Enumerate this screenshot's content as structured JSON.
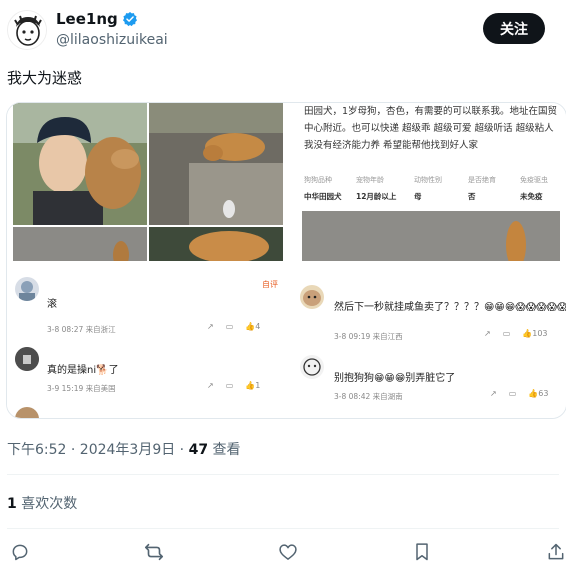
{
  "author": {
    "display_name": "Lee1ng",
    "handle": "@lilaoshizuikeai",
    "follow_label": "关注",
    "verified_color": "#1d9bf0"
  },
  "tweet": {
    "text": "我大为迷惑"
  },
  "media": {
    "post_excerpt": "田园犬，1岁母狗，杏色，有需要的可以联系我。地址在国贸中心附近。也可以快递 超级乖 超级可爱 超级听话 超级粘人 我没有经济能力养 希望能帮他找到好人家",
    "info": [
      {
        "head": "狗狗品种",
        "value": "中华田园犬"
      },
      {
        "head": "宠物年龄",
        "value": "12月龄以上"
      },
      {
        "head": "动物性别",
        "value": "母"
      },
      {
        "head": "是否绝育",
        "value": "否"
      },
      {
        "head": "免疫驱虫",
        "value": "未免疫"
      }
    ],
    "left_comments": [
      {
        "text": "滚",
        "meta": "3-8 08:27 来自浙江",
        "likes": "4"
      },
      {
        "text": "真的是操ni🐕了",
        "meta": "3-9 15:19 来自美国",
        "likes": "1"
      }
    ],
    "right_comments": [
      {
        "text": "然后下一秒就挂咸鱼卖了？？？？😁😁😁😱😱😱😱😱",
        "meta": "3-8 09:19 来自江西",
        "likes": "103"
      },
      {
        "text": "别抱狗狗😁😁😁别弄脏它了",
        "meta": "3-8 08:42 来自湖南",
        "likes": "63"
      }
    ],
    "author_tag": "自评"
  },
  "footer": {
    "time": "下午6:52 · 2024年3月9日 · ",
    "views_count": "47",
    "views_label": " 查看",
    "likes_count": "1",
    "likes_label": " 喜欢次数"
  }
}
